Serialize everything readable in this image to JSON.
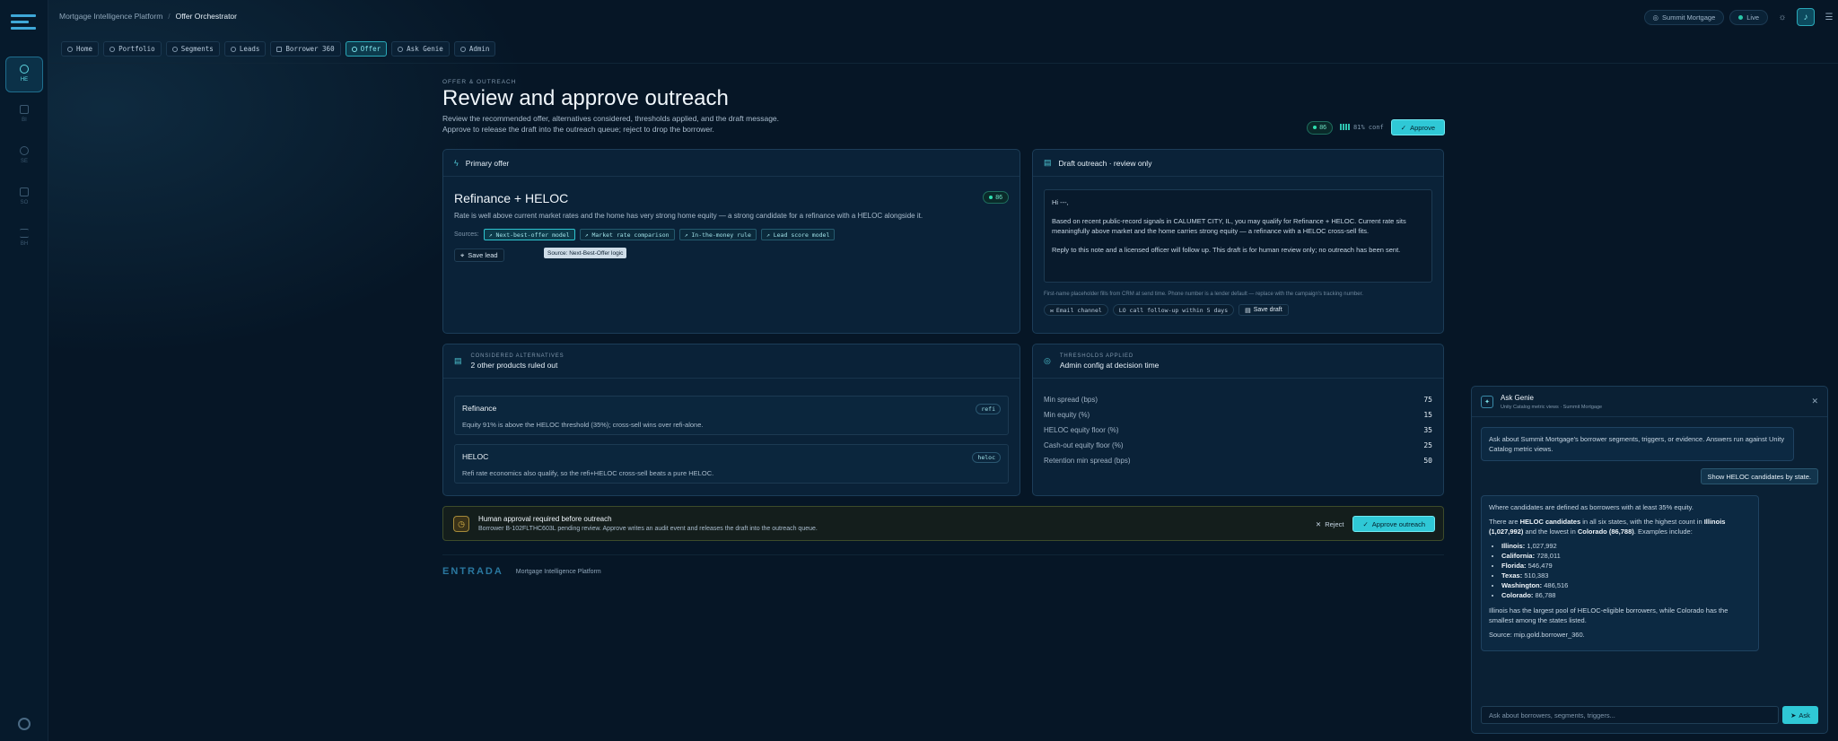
{
  "breadcrumb": {
    "root": "Mortgage Intelligence Platform",
    "sep": "/",
    "current": "Offer Orchestrator"
  },
  "topbar": {
    "org": "Summit Mortgage",
    "status": "Live"
  },
  "rail": {
    "items": [
      {
        "label": "HE"
      },
      {
        "label": "BI"
      },
      {
        "label": "SE"
      },
      {
        "label": "SO"
      },
      {
        "label": "BH"
      }
    ]
  },
  "tabs": [
    {
      "label": "Home"
    },
    {
      "label": "Portfolio"
    },
    {
      "label": "Segments"
    },
    {
      "label": "Leads"
    },
    {
      "label": "Borrower 360"
    },
    {
      "label": "Offer"
    },
    {
      "label": "Ask Genie"
    },
    {
      "label": "Admin"
    }
  ],
  "header": {
    "eyebrow": "OFFER & OUTREACH",
    "title": "Review and approve outreach",
    "subtitle_1": "Review the recommended offer, alternatives considered, thresholds applied, and the draft message.",
    "subtitle_2": "Approve to release the draft into the outreach queue; reject to drop the borrower.",
    "score": "86",
    "confidence": "81% conf",
    "approve": "Approve"
  },
  "primary_offer": {
    "header": "Primary offer",
    "title": "Refinance + HELOC",
    "score": "86",
    "description": "Rate is well above current market rates and the home has very strong home equity — a strong candidate for a refinance with a HELOC alongside it.",
    "sources_label": "Sources:",
    "sources": [
      "Next-best-offer model",
      "Market rate comparison",
      "In-the-money rule",
      "Lead score model"
    ],
    "save_lead": "Save lead",
    "tooltip": "Source: Next-Best-Offer logic"
  },
  "draft": {
    "header": "Draft outreach · review only",
    "greeting": "Hi ---,",
    "body_1": "Based on recent public-record signals in CALUMET CITY, IL, you may qualify for Refinance + HELOC. Current rate sits meaningfully above market and the home carries strong equity — a refinance with a HELOC cross-sell fits.",
    "body_2": "Reply to this note and a licensed officer will follow up. This draft is for human review only; no outreach has been sent.",
    "note": "First-name placeholder fills from CRM at send time. Phone number is a lender default — replace with the campaign's tracking number.",
    "channel": "Email channel",
    "followup": "LO call follow-up within 5 days",
    "save": "Save draft"
  },
  "alternatives": {
    "eyebrow": "CONSIDERED ALTERNATIVES",
    "title": "2 other products ruled out",
    "items": [
      {
        "name": "Refinance",
        "badge": "refi",
        "desc": "Equity 91% is above the HELOC threshold (35%); cross-sell wins over refi-alone."
      },
      {
        "name": "HELOC",
        "badge": "heloc",
        "desc": "Refi rate economics also qualify, so the refi+HELOC cross-sell beats a pure HELOC."
      }
    ]
  },
  "thresholds": {
    "eyebrow": "THRESHOLDS APPLIED",
    "title": "Admin config at decision time",
    "rows": [
      {
        "label": "Min spread (bps)",
        "value": "75"
      },
      {
        "label": "Min equity (%)",
        "value": "15"
      },
      {
        "label": "HELOC equity floor (%)",
        "value": "35"
      },
      {
        "label": "Cash-out equity floor (%)",
        "value": "25"
      },
      {
        "label": "Retention min spread (bps)",
        "value": "50"
      }
    ]
  },
  "approval": {
    "title": "Human approval required before outreach",
    "subtitle": "Borrower B-102FLTHC603L pending review. Approve writes an audit event and releases the draft into the outreach queue.",
    "reject": "Reject",
    "approve": "Approve outreach"
  },
  "footer": {
    "brand": "ENTRADA",
    "product": "Mortgage Intelligence Platform"
  },
  "genie": {
    "title": "Ask Genie",
    "subtitle": "Unity Catalog metric views · Summit Mortgage",
    "intro": "Ask about Summit Mortgage's borrower segments, triggers, or evidence. Answers run against Unity Catalog metric views.",
    "user_msg": "Show HELOC candidates by state.",
    "answer_1": "Where candidates are defined as borrowers with at least 35% equity.",
    "answer_2a": "There are ",
    "answer_2b": "HELOC candidates",
    "answer_2c": " in all six states, with the highest count in ",
    "answer_2d": "Illinois (1,027,992)",
    "answer_2e": " and the lowest in ",
    "answer_2f": "Colorado (86,788)",
    "answer_2g": ". Examples include:",
    "states": [
      {
        "name": "Illinois:",
        "value": "1,027,992"
      },
      {
        "name": "California:",
        "value": "728,011"
      },
      {
        "name": "Florida:",
        "value": "546,479"
      },
      {
        "name": "Texas:",
        "value": "510,383"
      },
      {
        "name": "Washington:",
        "value": "486,516"
      },
      {
        "name": "Colorado:",
        "value": "86,788"
      }
    ],
    "answer_3": "Illinois has the largest pool of HELOC-eligible borrowers, while Colorado has the smallest among the states listed.",
    "source": "Source: mip.gold.borrower_360.",
    "placeholder": "Ask about borrowers, segments, triggers...",
    "send": "Ask"
  }
}
